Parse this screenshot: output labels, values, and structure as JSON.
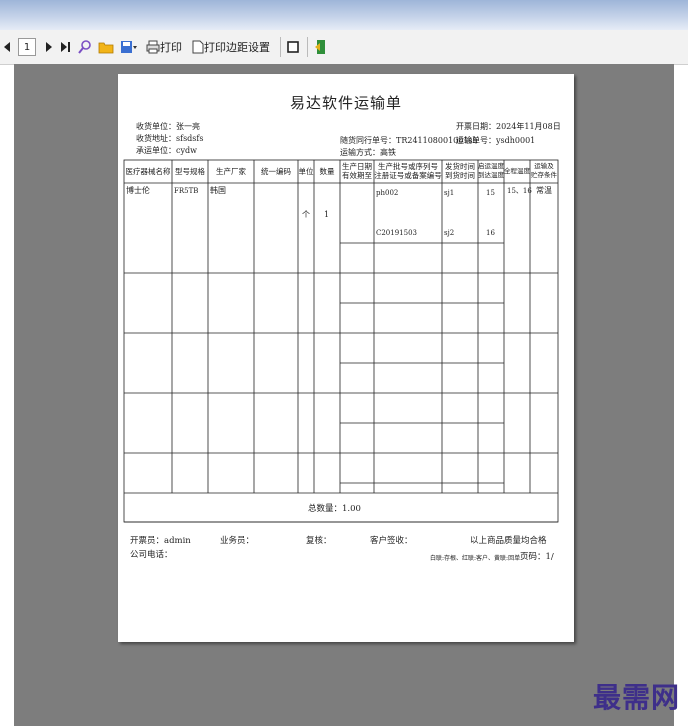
{
  "toolbar": {
    "page_number": "1",
    "print_label": "打印",
    "print_setup_label": "打印边距设置"
  },
  "doc": {
    "title": "易达软件运输单",
    "receiver": "收货单位：张一亮",
    "ship_address": "收货地址：sfsdsfs",
    "carrier": "承运单位：cydw",
    "open_date": "开票日期：2024年11月08日",
    "ref_no": "随货同行单号：TR241108001001sh",
    "transport_no": "运输单号：ysdh0001",
    "transport_method": "运输方式：高铁",
    "columns": [
      "医疗器械名称",
      "型号规格",
      "生产厂家",
      "统一编码",
      "单位",
      "数量",
      "生产日期\n有效期至",
      "生产批号或序列号\n注册证号或备案编号",
      "发货时间\n到货时间",
      "启运温度\n到达温度",
      "全程温度",
      "运输及\n贮存条件"
    ],
    "row": {
      "name": "博士伦",
      "spec": "FR5TB",
      "maker": "韩国",
      "unit": "个",
      "qty": "1",
      "batch": "ph002",
      "reg": "C20191503",
      "send_time": "sj1",
      "arrive_time": "sj2",
      "start_temp": "15",
      "end_temp": "16",
      "full_temp": "15、16",
      "storage": "常温"
    },
    "total": "总数量：1.00",
    "issuer": "开票员：admin",
    "salesman": "业务员：",
    "reviewer": "复核：",
    "customer_sign": "客户签收：",
    "quality_note": "以上商品质量均合格",
    "company_phone": "公司电话：",
    "copies_note": "白联:存根、红联:客户、黄联:回单",
    "page_label": "页码：1/"
  },
  "watermark": "最需网"
}
